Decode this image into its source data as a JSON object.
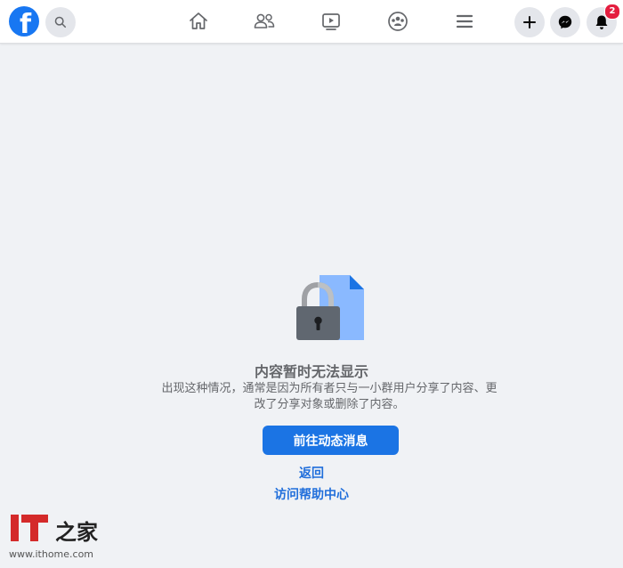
{
  "topbar": {
    "logo": {
      "letter": "f",
      "color": "#1877f2"
    },
    "search_icon": "search-icon",
    "nav": [
      "home-icon",
      "friends-icon",
      "watch-icon",
      "groups-icon",
      "menu-icon"
    ],
    "right": {
      "create_icon": "plus-icon",
      "messenger_icon": "messenger-icon",
      "notifications_icon": "bell-icon",
      "notification_count": "2"
    }
  },
  "content": {
    "icon": "lock-document-icon",
    "title": "内容暂时无法显示",
    "description": "出现这种情况，通常是因为所有者只与一小群用户分享了内容、更改了分享对象或删除了内容。",
    "primary_button": "前往动态消息",
    "back_link": "返回",
    "help_link": "访问帮助中心"
  },
  "watermark": {
    "logo_text": "IT",
    "chars": "之家",
    "url": "www.ithome.com"
  },
  "colors": {
    "brand": "#1877f2",
    "background": "#f0f2f5",
    "link": "#216fdb",
    "badge": "#e41e3f"
  }
}
